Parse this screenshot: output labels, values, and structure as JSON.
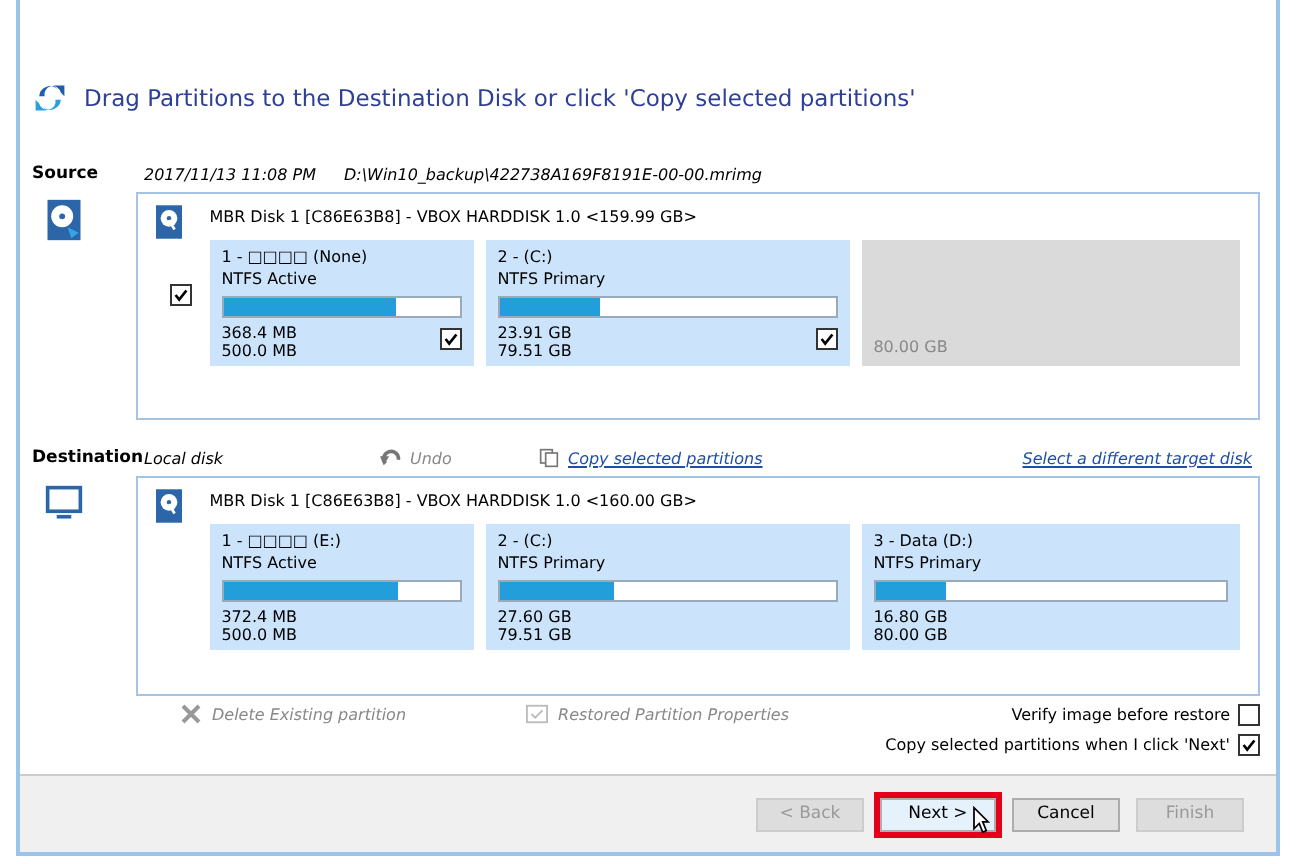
{
  "header": {
    "title": "Drag Partitions to the Destination Disk or click 'Copy selected partitions'"
  },
  "source": {
    "label": "Source",
    "date": "2017/11/13 11:08 PM",
    "path": "D:\\Win10_backup\\422738A169F8191E-00-00.mrimg",
    "disk_title": "MBR Disk 1 [C86E63B8] - VBOX HARDDISK 1.0  <159.99 GB>",
    "checked": true,
    "partitions": [
      {
        "kind": "partition",
        "name": "1 - □□□□ (None)",
        "type": "NTFS Active",
        "level": 0.73,
        "used": "368.4 MB",
        "total": "500.0 MB",
        "checked": true
      },
      {
        "kind": "partition",
        "name": "2 -  (C:)",
        "type": "NTFS Primary",
        "level": 0.3,
        "used": "23.91 GB",
        "total": "79.51 GB",
        "checked": true
      },
      {
        "kind": "unallocated",
        "total": "80.00 GB"
      }
    ]
  },
  "destination": {
    "label": "Destination",
    "disk_type": "Local disk",
    "undo": "Undo",
    "copy_link": "Copy selected partitions",
    "select_link": "Select a different target disk",
    "disk_title": "MBR Disk 1 [C86E63B8] - VBOX HARDDISK 1.0  <160.00 GB>",
    "partitions": [
      {
        "kind": "partition",
        "name": "1 - □□□□ (E:)",
        "type": "NTFS Active",
        "level": 0.74,
        "used": "372.4 MB",
        "total": "500.0 MB"
      },
      {
        "kind": "partition",
        "name": "2 -  (C:)",
        "type": "NTFS Primary",
        "level": 0.34,
        "used": "27.60 GB",
        "total": "79.51 GB"
      },
      {
        "kind": "partition",
        "name": "3 - Data (D:)",
        "type": "NTFS Primary",
        "level": 0.2,
        "used": "16.80 GB",
        "total": "80.00 GB"
      }
    ]
  },
  "actions": {
    "delete": "Delete Existing partition",
    "properties": "Restored Partition Properties"
  },
  "options": [
    {
      "label": "Verify image before restore",
      "checked": false
    },
    {
      "label": "Copy selected partitions when I click 'Next'",
      "checked": true
    }
  ],
  "buttons": [
    {
      "label": "< Back",
      "disabled": true,
      "highlighted": false
    },
    {
      "label": "Next >",
      "disabled": false,
      "highlighted": true
    },
    {
      "label": "Cancel",
      "disabled": false,
      "highlighted": false
    },
    {
      "label": "Finish",
      "disabled": true,
      "highlighted": false
    }
  ]
}
